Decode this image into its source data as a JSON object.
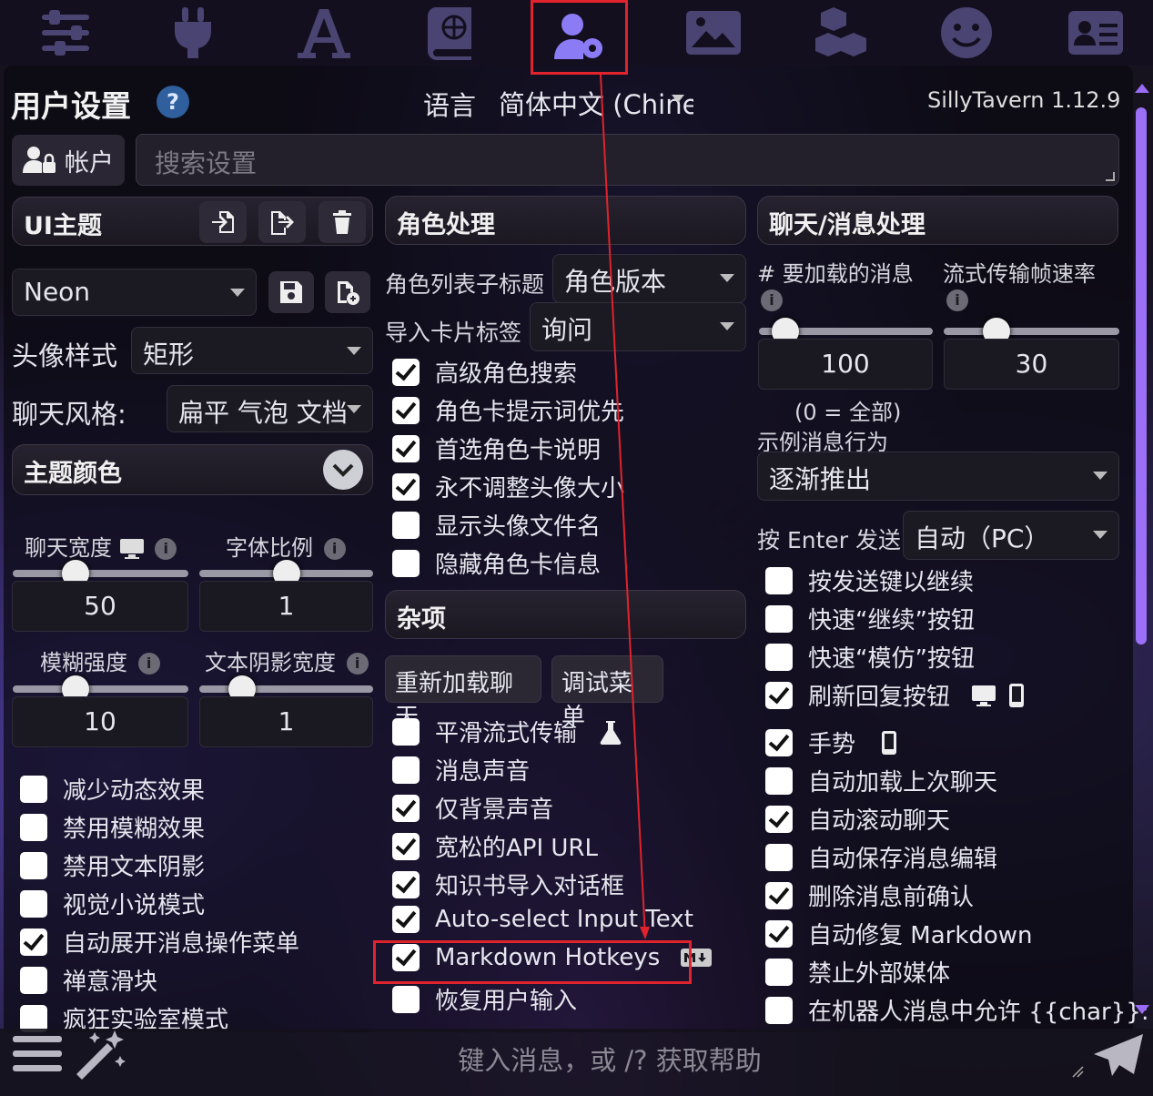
{
  "topbar": {
    "icons": [
      "sliders-icon",
      "plug-icon",
      "font-icon",
      "book-globe-icon",
      "user-gear-icon",
      "image-icon",
      "cubes-icon",
      "smiley-icon",
      "id-card-icon"
    ],
    "active_color": "#8b7cf6",
    "icon_color": "#4a4472"
  },
  "header": {
    "title": "用户设置",
    "help": "?",
    "lang_label": "语言",
    "lang_value": "简体中文 (Chine",
    "version": "SillyTavern 1.12.9"
  },
  "account": {
    "label": "帐户"
  },
  "search": {
    "placeholder": "搜索设置"
  },
  "col1": {
    "ui_theme_header": "UI主题",
    "theme_select": "Neon",
    "avatar_style_label": "头像样式",
    "avatar_style_value": "矩形",
    "chat_style_label": "聊天风格:",
    "chat_style_value": "扁平 气泡 文档",
    "theme_colors_header": "主题颜色",
    "chat_width_label": "聊天宽度",
    "font_scale_label": "字体比例",
    "chat_width_value": "50",
    "font_scale_value": "1",
    "blur_label": "模糊强度",
    "text_shadow_label": "文本阴影宽度",
    "blur_value": "10",
    "text_shadow_value": "1",
    "checkboxes": [
      {
        "label": "减少动态效果",
        "checked": false
      },
      {
        "label": "禁用模糊效果",
        "checked": false
      },
      {
        "label": "禁用文本阴影",
        "checked": false
      },
      {
        "label": "视觉小说模式",
        "checked": false
      },
      {
        "label": "自动展开消息操作菜单",
        "checked": true
      },
      {
        "label": "禅意滑块",
        "checked": false
      },
      {
        "label": "疯狂实验室模式",
        "checked": false
      }
    ]
  },
  "col2": {
    "char_handling_header": "角色处理",
    "char_list_subtitle_label": "角色列表子标题",
    "char_list_subtitle_value": "角色版本",
    "import_tags_label": "导入卡片标签",
    "import_tags_value": "询问",
    "char_checkboxes": [
      {
        "label": "高级角色搜索",
        "checked": true
      },
      {
        "label": "角色卡提示词优先",
        "checked": true
      },
      {
        "label": "首选角色卡说明",
        "checked": true
      },
      {
        "label": "永不调整头像大小",
        "checked": true
      },
      {
        "label": "显示头像文件名",
        "checked": false
      },
      {
        "label": "隐藏角色卡信息",
        "checked": false
      }
    ],
    "misc_header": "杂项",
    "reload_chat_button": "重新加载聊天",
    "debug_menu_button": "调试菜单",
    "misc_checkboxes": [
      {
        "label": "平滑流式传输",
        "checked": false
      },
      {
        "label": "消息声音",
        "checked": false
      },
      {
        "label": "仅背景声音",
        "checked": true
      },
      {
        "label": "宽松的API URL",
        "checked": true
      },
      {
        "label": "知识书导入对话框",
        "checked": true
      },
      {
        "label": "Auto-select Input Text",
        "checked": true
      },
      {
        "label": "Markdown Hotkeys",
        "checked": true
      },
      {
        "label": "恢复用户输入",
        "checked": false
      }
    ]
  },
  "col3": {
    "chat_handling_header": "聊天/消息处理",
    "messages_to_load_label": "# 要加载的消息",
    "stream_fps_label": "流式传输帧速率",
    "messages_to_load_value": "100",
    "stream_fps_value": "30",
    "zero_all_note": "(0 = 全部)",
    "example_behavior_label": "示例消息行为",
    "example_behavior_value": "逐渐推出",
    "enter_send_label": "按 Enter 发送",
    "enter_send_value": "自动（PC）",
    "checkboxes": [
      {
        "label": "按发送键以继续",
        "checked": false
      },
      {
        "label": "快速“继续”按钮",
        "checked": false
      },
      {
        "label": "快速“模仿”按钮",
        "checked": false
      },
      {
        "label": "刷新回复按钮",
        "checked": true
      },
      {
        "label": "手势",
        "checked": true
      },
      {
        "label": "自动加载上次聊天",
        "checked": false
      },
      {
        "label": "自动滚动聊天",
        "checked": true
      },
      {
        "label": "自动保存消息编辑",
        "checked": false
      },
      {
        "label": "删除消息前确认",
        "checked": true
      },
      {
        "label": "自动修复 Markdown",
        "checked": true
      },
      {
        "label": "禁止外部媒体",
        "checked": false
      },
      {
        "label": "在机器人消息中允许 {{char}}:",
        "checked": false
      }
    ]
  },
  "chatbar": {
    "placeholder": "键入消息，或 /? 获取帮助"
  },
  "colors": {
    "highlight": "#e0232c",
    "scroll_thumb": "#9c6ff7"
  }
}
